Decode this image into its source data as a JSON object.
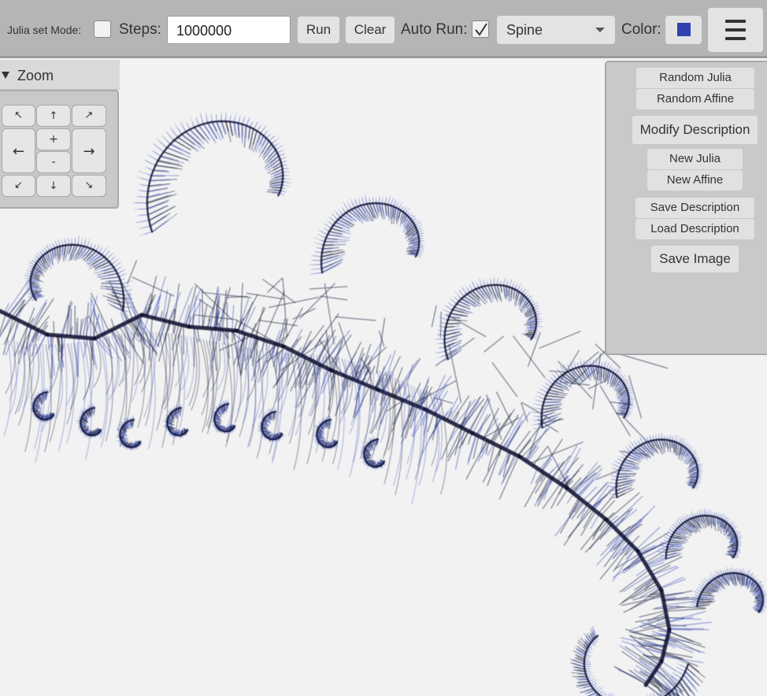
{
  "toolbar": {
    "julia_mode_label": "Julia set Mode:",
    "julia_mode_checked": false,
    "steps_label": "Steps:",
    "steps_value": "1000000",
    "run_label": "Run",
    "clear_label": "Clear",
    "auto_run_label": "Auto Run:",
    "auto_run_checked": true,
    "preset_selected": "Spine",
    "color_label": "Color:",
    "color_value": "#2f42b0",
    "menu_icon": "hamburger-menu-icon"
  },
  "zoom": {
    "title": "Zoom",
    "expanded": true,
    "buttons": {
      "up_left": "↖",
      "up": "↑",
      "up_right": "↗",
      "left": "←",
      "zoom_in": "+",
      "zoom_out": "-",
      "right": "→",
      "down_left": "↙",
      "down": "↓",
      "down_right": "↘"
    }
  },
  "panel": {
    "random_julia": "Random Julia",
    "random_affine": "Random Affine",
    "modify_description": "Modify Description",
    "new_julia": "New Julia",
    "new_affine": "New Affine",
    "save_description": "Save Description",
    "load_description": "Load Description",
    "save_image": "Save Image"
  },
  "colors": {
    "toolbar_bg": "#b5b5b5",
    "canvas_bg": "#f2f2f2",
    "fractal_dark": "#0b0f2e",
    "fractal_light": "#3b4fb8"
  }
}
